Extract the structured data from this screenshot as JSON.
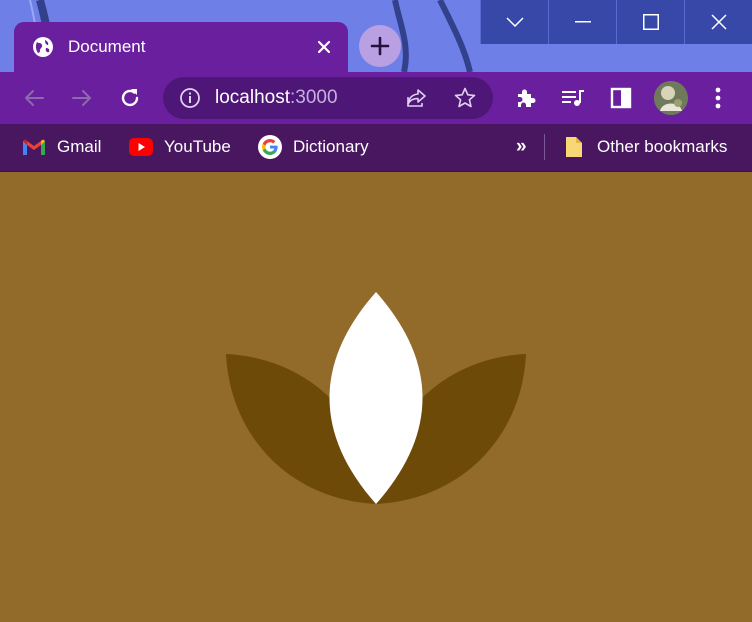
{
  "window": {
    "caption_buttons": [
      {
        "name": "tab-search-button",
        "icon": "chevron-down-icon"
      },
      {
        "name": "minimize-button",
        "icon": "minimize-icon"
      },
      {
        "name": "maximize-button",
        "icon": "maximize-icon"
      },
      {
        "name": "close-window-button",
        "icon": "close-icon"
      }
    ]
  },
  "tab": {
    "title": "Document",
    "icon": "globe-icon",
    "close_icon": "close-icon"
  },
  "new_tab": {
    "icon": "plus-icon"
  },
  "toolbar": {
    "back_icon": "arrow-left-icon",
    "forward_icon": "arrow-right-icon",
    "reload_icon": "reload-icon",
    "extensions_icon": "puzzle-icon",
    "media_icon": "queue-music-icon",
    "side_panel_icon": "side-panel-icon",
    "menu_icon": "more-vertical-icon"
  },
  "omnibox": {
    "host": "localhost",
    "port": ":3000",
    "info_icon": "info-icon",
    "share_icon": "share-icon",
    "star_icon": "star-icon"
  },
  "bookmarks": {
    "items": [
      {
        "label": "Gmail",
        "icon": "gmail-icon"
      },
      {
        "label": "YouTube",
        "icon": "youtube-icon"
      },
      {
        "label": "Dictionary",
        "icon": "google-icon"
      }
    ],
    "overflow": "»",
    "other": {
      "label": "Other bookmarks",
      "icon": "folder-icon"
    }
  },
  "page": {
    "background": "#926a2a",
    "petal_side_color": "#6e4a08",
    "petal_center_color": "#ffffff"
  },
  "colors": {
    "tab_purple": "#6a1f9e",
    "bookmarks_bar": "#48175f",
    "caption_blue": "#3848a8",
    "wallpaper": "#6f7fe8"
  }
}
